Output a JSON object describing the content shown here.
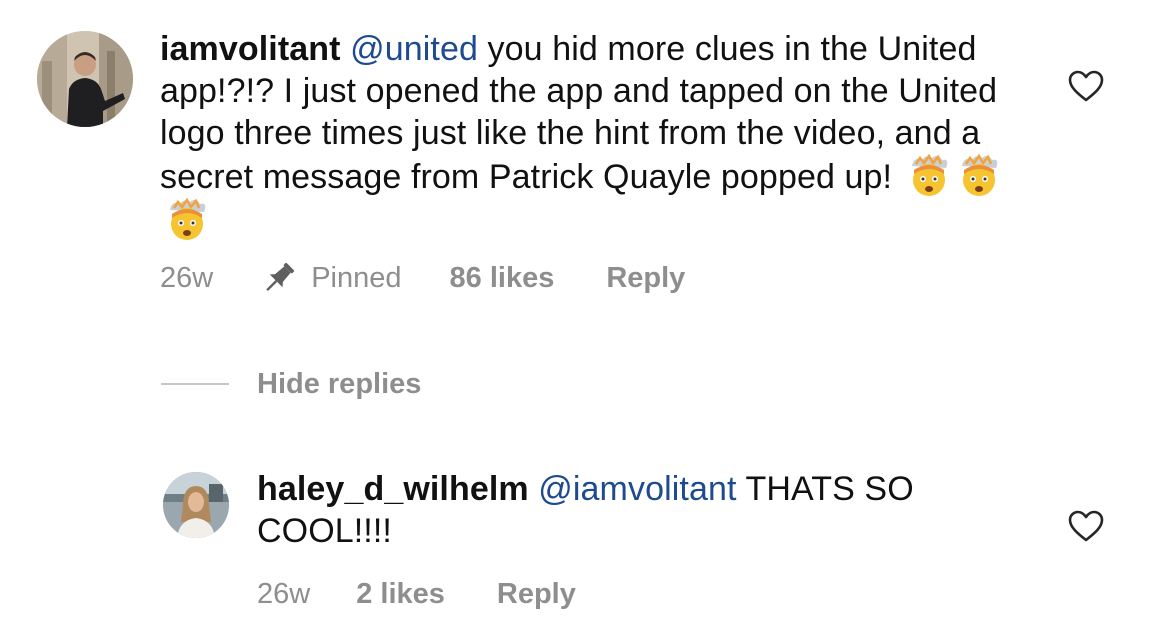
{
  "comment": {
    "username": "iamvolitant",
    "mention": "@united",
    "text": " you hid more clues in the United app!?!? I just opened the app and tapped on the United logo three times just like the hint from the video, and a secret message from Patrick Quayle popped up! ",
    "emojis": [
      "exploding-head-emoji",
      "exploding-head-emoji",
      "exploding-head-emoji"
    ],
    "age": "26w",
    "pinned_label": "Pinned",
    "likes": "86 likes",
    "reply_label": "Reply"
  },
  "hide_replies_label": "Hide replies",
  "reply": {
    "username": "haley_d_wilhelm",
    "mention": "@iamvolitant",
    "text": " THATS SO COOL!!!!",
    "age": "26w",
    "likes": "2 likes",
    "reply_label": "Reply"
  },
  "icons": {
    "like": "heart-outline-icon",
    "pinned": "pushpin-icon"
  },
  "colors": {
    "mention": "#1e4b8f",
    "meta": "#8e8e8e"
  }
}
